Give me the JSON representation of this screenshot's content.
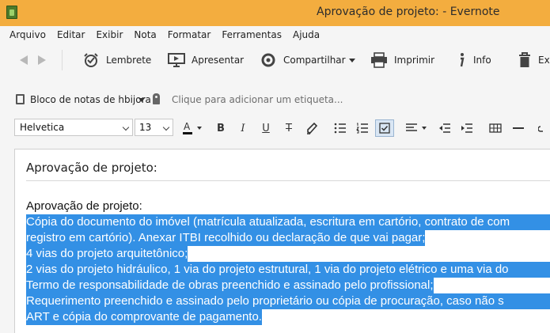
{
  "window": {
    "title": "Aprovação de projeto: - Evernote"
  },
  "menu": [
    "Arquivo",
    "Editar",
    "Exibir",
    "Nota",
    "Formatar",
    "Ferramentas",
    "Ajuda"
  ],
  "toolbar": {
    "reminder_label": "Lembrete",
    "present_label": "Apresentar",
    "share_label": "Compartilhar",
    "print_label": "Imprimir",
    "info_label": "Info",
    "delete_label": "Ex"
  },
  "notebook": {
    "label": "Bloco de notas de hbijora",
    "tag_placeholder": "Clique para adicionar um etiqueta..."
  },
  "format": {
    "font": "Helvetica",
    "size": "13"
  },
  "note": {
    "title": "Aprovação de projeto:",
    "heading": "Aprovação de projeto:",
    "lines": [
      "Cópia do documento do imóvel (matrícula atualizada, escritura em cartório, contrato de com",
      "registro em cartório). Anexar ITBI recolhido ou declaração de que vai pagar;",
      "4 vias do projeto arquitetônico;",
      "2 vias do projeto hidráulico, 1 via do projeto estrutural, 1 via do projeto elétrico e uma via do",
      "Termo de responsabilidade de obras preenchido e assinado pelo profissional;",
      "Requerimento preenchido e assinado pelo proprietário ou cópia de procuração, caso não s",
      "ART e cópia do comprovante de pagamento."
    ]
  },
  "colors": {
    "titlebar": "#f3ad3f",
    "selection": "#3390e5"
  }
}
